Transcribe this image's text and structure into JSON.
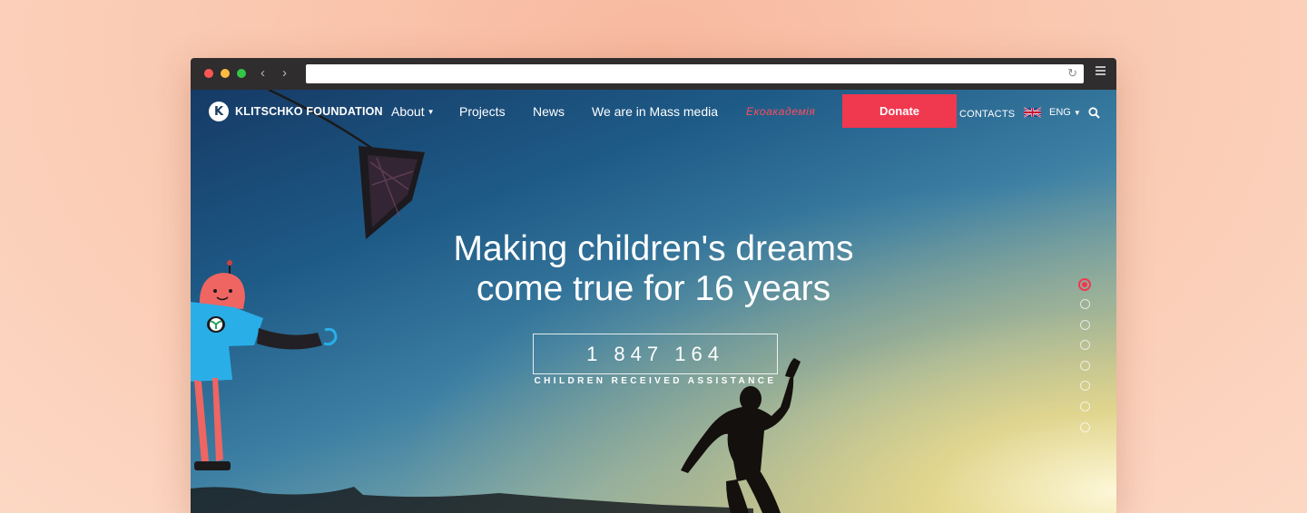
{
  "nav": {
    "logo_mark": "K",
    "logo_text": "KLITSCHKO FOUNDATION",
    "items": [
      {
        "label": "About"
      },
      {
        "label": "Projects"
      },
      {
        "label": "News"
      },
      {
        "label": "We are in Mass media"
      }
    ],
    "eco_label": "Екоакадемія",
    "donate_label": "Donate",
    "contacts_label": "CONTACTS",
    "language": "ENG",
    "icons": [
      "flag-uk-icon",
      "search-icon",
      "chevron-down-icon"
    ]
  },
  "hero": {
    "headline_line1": "Making children's dreams",
    "headline_line2": "come true for 16 years",
    "counter_value": "1 847 164",
    "counter_label": "CHILDREN RECEIVED ASSISTANCE",
    "slides_total": 8,
    "active_slide": 1
  },
  "browser": {
    "url": "",
    "icons": [
      "back-icon",
      "forward-icon",
      "reload-icon",
      "menu-icon"
    ]
  },
  "colors": {
    "accent": "#f0384f",
    "eco_label": "#ff4d5e",
    "chrome": "#2f2d2e"
  }
}
